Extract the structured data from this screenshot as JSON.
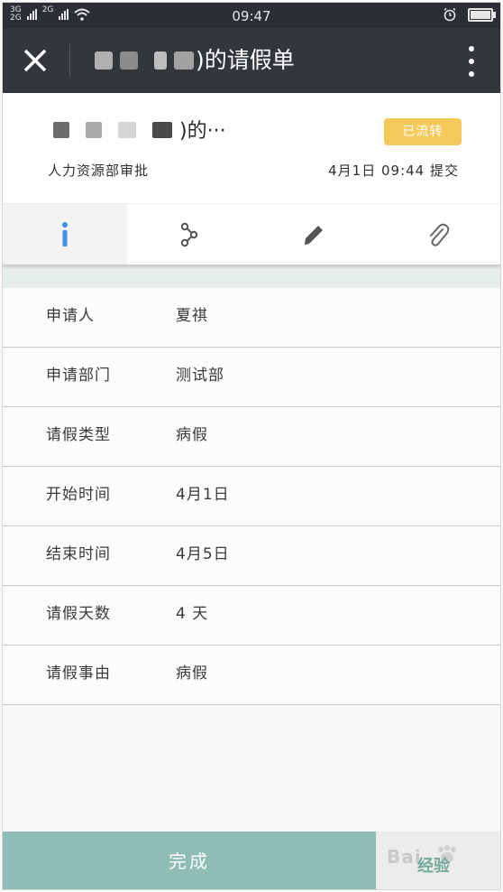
{
  "status_bar": {
    "network_top": "3G",
    "network_bottom": "2G",
    "network2": "2G",
    "time": "09:47",
    "battery_level": 0.9,
    "icons": [
      "signal-icon",
      "wifi-icon",
      "alarm-icon",
      "battery-icon"
    ]
  },
  "title_bar": {
    "title_suffix": ")的请假单",
    "icons": [
      "close-icon",
      "more-vertical-icon"
    ]
  },
  "summary": {
    "title_suffix": ")的···",
    "status_badge": "已流转",
    "department": "人力资源部审批",
    "submitted": "4月1日 09:44 提交",
    "colors": {
      "badge": "#f5c85c"
    }
  },
  "tabs": [
    {
      "name": "info",
      "icon": "info-icon",
      "active": true
    },
    {
      "name": "flow",
      "icon": "flow-icon",
      "active": false
    },
    {
      "name": "edit",
      "icon": "pencil-icon",
      "active": false
    },
    {
      "name": "attachment",
      "icon": "paperclip-icon",
      "active": false
    }
  ],
  "details": [
    {
      "label": "申请人",
      "value": "夏祺"
    },
    {
      "label": "申请部门",
      "value": "测试部"
    },
    {
      "label": "请假类型",
      "value": "病假"
    },
    {
      "label": "开始时间",
      "value": "4月1日"
    },
    {
      "label": "结束时间",
      "value": "4月5日"
    },
    {
      "label": "请假天数",
      "value": "4 天"
    },
    {
      "label": "请假事由",
      "value": "病假"
    }
  ],
  "footer": {
    "done_label": "完成",
    "watermark_text": "Bai",
    "watermark_sub": "经验",
    "colors": {
      "done": "#8fbdb5",
      "info_icon": "#3a8fe0"
    }
  }
}
